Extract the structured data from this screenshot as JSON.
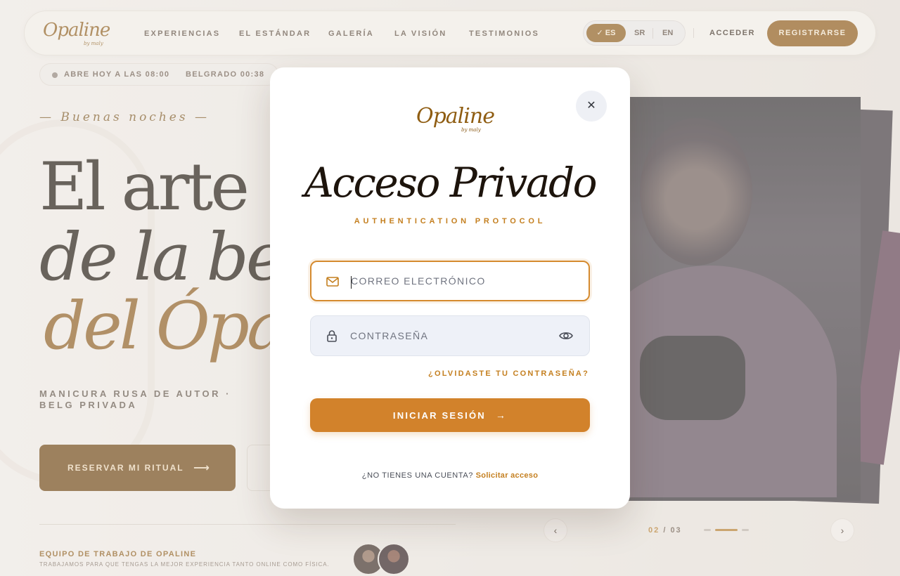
{
  "brand": {
    "name": "Opaline",
    "sub": "by maly"
  },
  "nav": {
    "items": [
      "EXPERIENCIAS",
      "EL ESTÁNDAR",
      "GALERÍA",
      "LA VISIÓN",
      "TESTIMONIOS"
    ],
    "languages": {
      "active": "ES",
      "others": [
        "SR",
        "EN"
      ]
    },
    "login": "ACCEDER",
    "register": "REGISTRARSE"
  },
  "status": {
    "open": "ABRE HOY A LAS 08:00",
    "city_time": "BELGRADO 00:38"
  },
  "hero": {
    "greeting": "— Buenas noches —",
    "line1": "El arte",
    "line2": "de la bel",
    "line3": "del Ópa",
    "description": "MANICURA RUSA DE AUTOR · BELG PRIVADA",
    "cta": "RESERVAR MI RITUAL",
    "cta_arrow": "⟶"
  },
  "team": {
    "title": "EQUIPO DE TRABAJO DE OPALINE",
    "description": "TRABAJAMOS PARA QUE TENGAS LA MEJOR EXPERIENCIA TANTO ONLINE COMO FÍSICA."
  },
  "slider": {
    "current": "02",
    "separator": "/",
    "total": "03",
    "prev": "‹",
    "next": "›"
  },
  "modal": {
    "close": "✕",
    "title": "Acceso Privado",
    "subtitle": "AUTHENTICATION PROTOCOL",
    "email": {
      "placeholder": "CORREO ELECTRÓNICO",
      "value": ""
    },
    "password": {
      "placeholder": "CONTRASEÑA",
      "value": ""
    },
    "forgot": "¿OLVIDASTE TU CONTRASEÑA?",
    "submit": "INICIAR SESIÓN",
    "submit_arrow": "→",
    "signup_prompt": "¿NO TIENES UNA CUENTA?",
    "signup_link": "Solicitar acceso"
  },
  "icons": {
    "email": "mail-icon",
    "password": "lock-icon",
    "reveal": "eye-icon",
    "close": "close-icon",
    "check": "check-icon"
  },
  "colors": {
    "accent": "#d2822b",
    "brand_brown": "#8a5512",
    "title_dark": "#1d140c",
    "field_bg": "#eef1f8"
  }
}
